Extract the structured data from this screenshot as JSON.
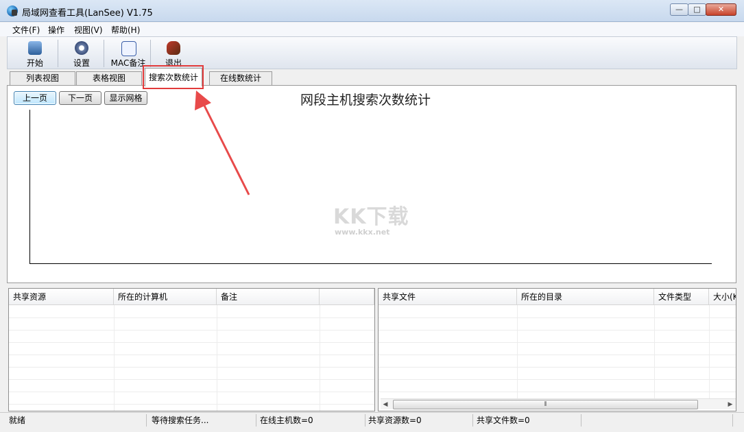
{
  "window": {
    "title": "局域网查看工具(LanSee) V1.75"
  },
  "menu": [
    "文件(F)",
    "操作",
    "视图(V)",
    "帮助(H)"
  ],
  "toolbar": [
    {
      "label": "开始",
      "icon": "start-icon"
    },
    {
      "label": "设置",
      "icon": "settings-gear-icon"
    },
    {
      "label": "MAC备注",
      "icon": "note-edit-icon"
    },
    {
      "label": "退出",
      "icon": "exit-icon"
    }
  ],
  "tabs": [
    "列表视图",
    "表格视图",
    "搜索次数统计",
    "在线数统计"
  ],
  "active_tab": "搜索次数统计",
  "chart_buttons": [
    "上一页",
    "下一页",
    "显示网格"
  ],
  "chart_title": "网段主机搜索次数统计",
  "share_table": {
    "columns": [
      "共享资源",
      "所在的计算机",
      "备注",
      ""
    ]
  },
  "file_table": {
    "columns": [
      "共享文件",
      "所在的目录",
      "文件类型",
      "大小(K"
    ]
  },
  "status": [
    "就绪",
    "等待搜索任务...",
    "在线主机数=0",
    "共享资源数=0",
    "共享文件数=0"
  ],
  "watermark": {
    "logo": "KK下载",
    "url": "www.kkx.net"
  },
  "colors": {
    "highlight": "#e23a3a",
    "titlebar": "#c8d9ee"
  }
}
